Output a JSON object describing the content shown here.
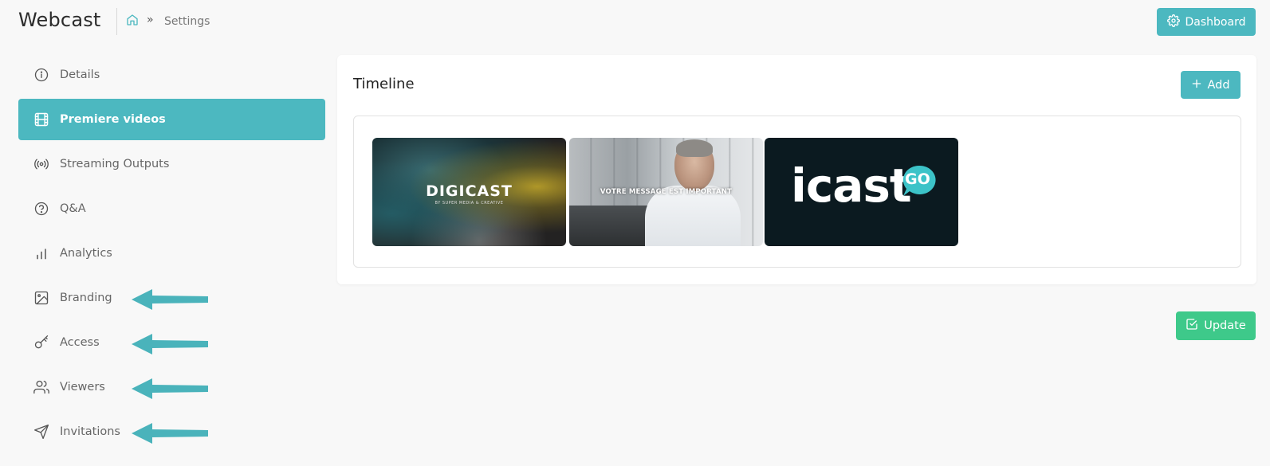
{
  "app": {
    "title": "Webcast"
  },
  "breadcrumb": {
    "separator": "»",
    "current": "Settings"
  },
  "header": {
    "dashboard_label": "Dashboard"
  },
  "sidebar": {
    "items": [
      {
        "label": "Details",
        "icon": "info-icon",
        "active": false
      },
      {
        "label": "Premiere videos",
        "icon": "film-icon",
        "active": true
      },
      {
        "label": "Streaming Outputs",
        "icon": "broadcast-icon",
        "active": false
      },
      {
        "label": "Q&A",
        "icon": "help-circle-icon",
        "active": false
      },
      {
        "label": "Analytics",
        "icon": "bar-chart-icon",
        "active": false
      },
      {
        "label": "Branding",
        "icon": "image-icon",
        "active": false,
        "arrow": true
      },
      {
        "label": "Access",
        "icon": "key-icon",
        "active": false,
        "arrow": true
      },
      {
        "label": "Viewers",
        "icon": "users-icon",
        "active": false,
        "arrow": true
      },
      {
        "label": "Invitations",
        "icon": "send-icon",
        "active": false,
        "arrow": true
      }
    ]
  },
  "main": {
    "title": "Timeline",
    "add_label": "Add",
    "videos": [
      {
        "title": "DIGICAST",
        "subtitle": "BY SUPER MEDIA & CREATIVE"
      },
      {
        "title": "VOTRE MESSAGE EST IMPORTANT"
      },
      {
        "title": "icast",
        "badge": "GO"
      }
    ]
  },
  "update_label": "Update",
  "colors": {
    "accent": "#4cb8c0",
    "success": "#3ec98a",
    "arrow": "#4ab3bb"
  }
}
